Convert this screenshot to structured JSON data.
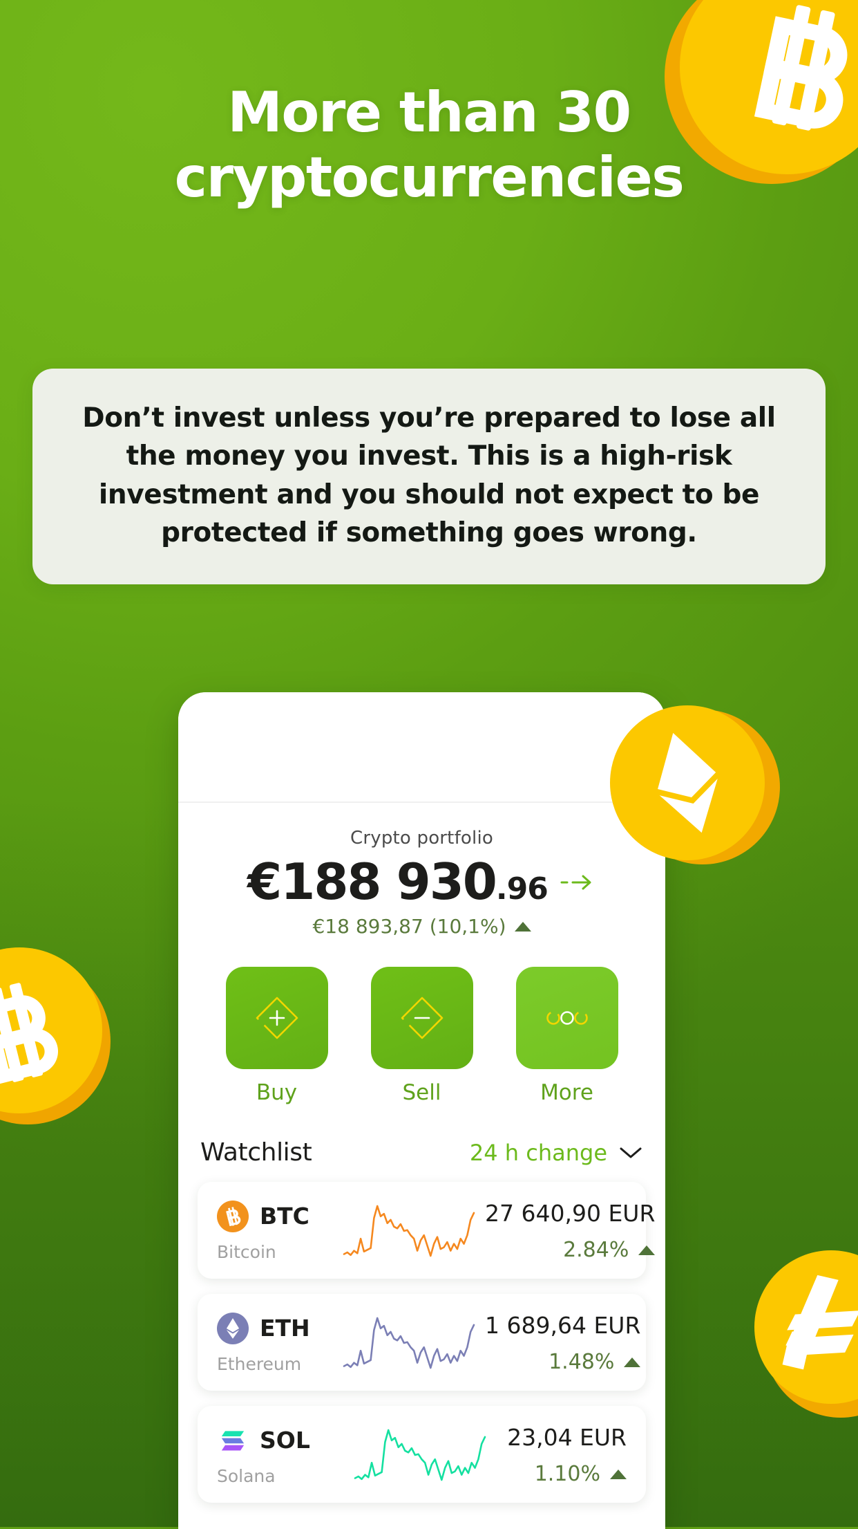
{
  "colors": {
    "bg_green": "#5f9e14",
    "bg_green_light": "#74b81a",
    "bg_green_dark": "#3c7a18",
    "coin_yellow": "#fcc800",
    "coin_rim": "#f2a900",
    "card_bg": "#edf0e8",
    "accent_green": "#6cba1c",
    "action_green": "#6fbf17",
    "action_green_light": "#7ccb2a",
    "positive_green": "#5a7a3c",
    "btc_orange": "#f2921d",
    "eth_purple": "#7b7fb5",
    "sol_teal": "#14e0a0"
  },
  "hero": {
    "title": "More than 30 cryptocurrencies"
  },
  "disclaimer": {
    "text": "Don’t invest unless you’re prepared to lose all the money you invest. This is a high-risk investment and you should not expect to be protected if something goes wrong."
  },
  "phone": {
    "portfolio": {
      "label": "Crypto portfolio",
      "amount_main": "€188 930",
      "amount_cents": ".96",
      "delta": "€18 893,87 (10,1%)",
      "delta_direction": "up",
      "arrow_icon": "arrow-right-icon"
    },
    "actions": [
      {
        "label": "Buy",
        "icon": "diamond-plus-icon",
        "style": "buy"
      },
      {
        "label": "Sell",
        "icon": "diamond-minus-icon",
        "style": "sell"
      },
      {
        "label": "More",
        "icon": "three-circles-icon",
        "style": "more"
      }
    ],
    "watchlist": {
      "title": "Watchlist",
      "filter_label": "24 h change",
      "filter_icon": "chevron-down-icon",
      "assets": [
        {
          "symbol": "BTC",
          "name": "Bitcoin",
          "icon": "bitcoin-icon",
          "price": "27 640,90 EUR",
          "change": "2.84%",
          "change_direction": "up",
          "spark_color": "#f5881f"
        },
        {
          "symbol": "ETH",
          "name": "Ethereum",
          "icon": "ethereum-icon",
          "price": "1 689,64 EUR",
          "change": "1.48%",
          "change_direction": "up",
          "spark_color": "#7b7fb5"
        },
        {
          "symbol": "SOL",
          "name": "Solana",
          "icon": "solana-icon",
          "price": "23,04 EUR",
          "change": "1.10%",
          "change_direction": "up",
          "spark_color": "#14e0a0"
        }
      ]
    }
  },
  "decorations": [
    {
      "name": "bitcoin-coin-top-right",
      "symbol": "₿"
    },
    {
      "name": "bitcoin-coin-left",
      "symbol": "₿"
    },
    {
      "name": "ethereum-coin",
      "symbol": "Ξ"
    },
    {
      "name": "litecoin-coin-bottom-right",
      "symbol": "Ł"
    }
  ],
  "chart_data": {
    "type": "line",
    "title": "Watchlist sparklines",
    "xlabel": "",
    "ylabel": "",
    "series": [
      {
        "name": "BTC",
        "values": [
          8,
          10,
          7,
          12,
          9,
          26,
          11,
          13,
          15,
          50,
          64,
          52,
          55,
          44,
          48,
          40,
          38,
          43,
          35,
          36,
          30,
          26,
          12,
          24,
          30,
          18,
          6,
          20,
          28,
          14,
          16,
          22,
          12,
          20,
          14,
          26,
          20,
          30,
          48,
          56
        ]
      },
      {
        "name": "ETH",
        "values": [
          8,
          10,
          7,
          12,
          9,
          26,
          11,
          13,
          15,
          50,
          64,
          52,
          55,
          44,
          48,
          40,
          38,
          43,
          35,
          36,
          30,
          26,
          12,
          24,
          30,
          18,
          6,
          20,
          28,
          14,
          16,
          22,
          12,
          20,
          14,
          26,
          20,
          30,
          48,
          56
        ]
      },
      {
        "name": "SOL",
        "values": [
          8,
          10,
          7,
          12,
          9,
          26,
          11,
          13,
          15,
          50,
          64,
          52,
          55,
          44,
          48,
          40,
          38,
          43,
          35,
          36,
          30,
          26,
          12,
          24,
          30,
          18,
          6,
          20,
          28,
          14,
          16,
          22,
          12,
          20,
          14,
          26,
          20,
          30,
          48,
          56
        ]
      }
    ]
  }
}
